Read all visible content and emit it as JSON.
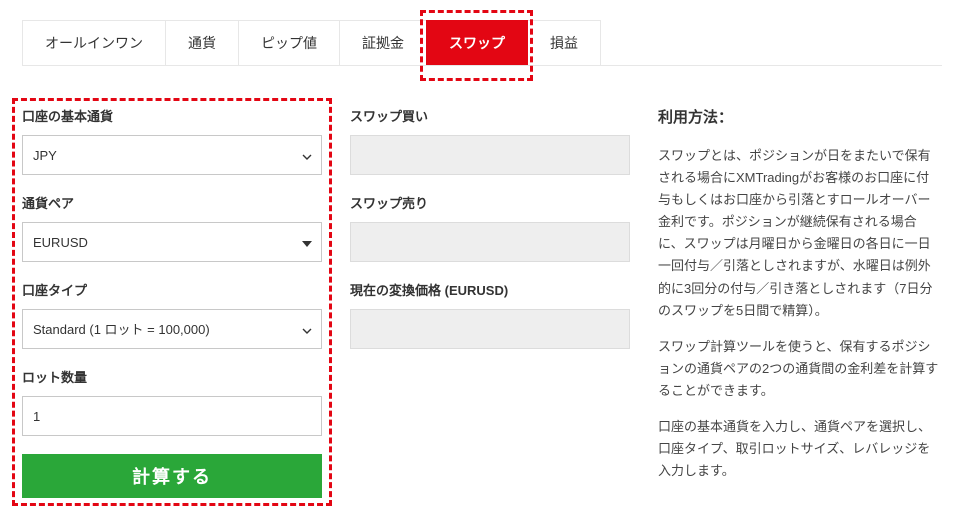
{
  "tabs": {
    "items": [
      {
        "label": "オールインワン"
      },
      {
        "label": "通貨"
      },
      {
        "label": "ピップ値"
      },
      {
        "label": "証拠金"
      },
      {
        "label": "スワップ"
      },
      {
        "label": "損益"
      }
    ],
    "active_index": 4
  },
  "form_left": {
    "base_currency": {
      "label": "口座の基本通貨",
      "value": "JPY"
    },
    "pair": {
      "label": "通貨ペア",
      "value": "EURUSD"
    },
    "account_type": {
      "label": "口座タイプ",
      "value": "Standard (1 ロット = 100,000)"
    },
    "lot": {
      "label": "ロット数量",
      "value": "1"
    },
    "calc_button": "計算する"
  },
  "form_middle": {
    "swap_buy": {
      "label": "スワップ買い"
    },
    "swap_sell": {
      "label": "スワップ売り"
    },
    "conv_rate": {
      "label": "現在の変換価格 (EURUSD)"
    }
  },
  "howto": {
    "title": "利用方法：",
    "p1": "スワップとは、ポジションが日をまたいで保有される場合にXMTradingがお客様のお口座に付与もしくはお口座から引落とすロールオーバー金利です。ポジションが継続保有される場合に、スワップは月曜日から金曜日の各日に一日一回付与／引落としされますが、水曜日は例外的に3回分の付与／引き落としされます（7日分のスワップを5日間で精算）。",
    "p2": "スワップ計算ツールを使うと、保有するポジションの通貨ペアの2つの通貨間の金利差を計算することができます。",
    "p3": "口座の基本通貨を入力し、通貨ペアを選択し、口座タイプ、取引ロットサイズ、レバレッジを入力します。"
  }
}
